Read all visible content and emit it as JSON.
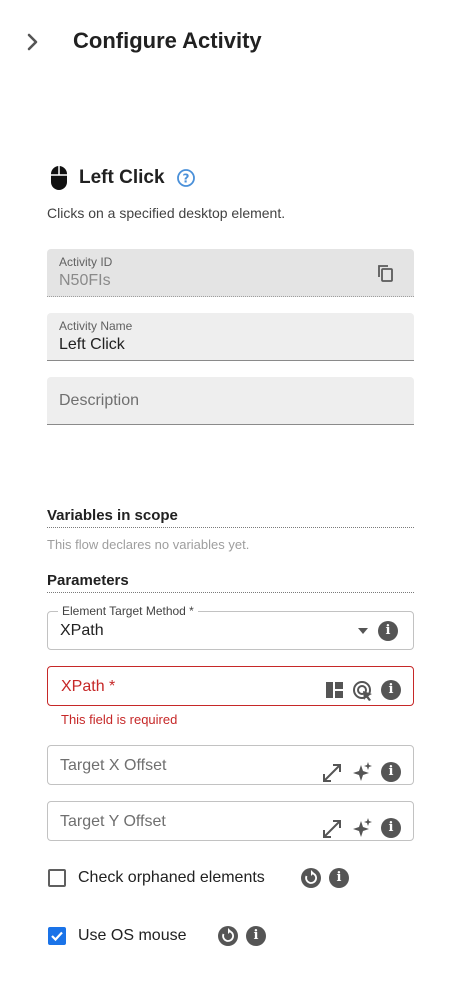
{
  "header": {
    "title": "Configure Activity",
    "toggle_icon": "chevron-right-icon"
  },
  "activity": {
    "icon": "mouse-icon",
    "name": "Left Click",
    "help_icon": "help-circle-icon",
    "description": "Clicks on a specified desktop element."
  },
  "fields": {
    "activity_id": {
      "label": "Activity ID",
      "value": "N50FIs",
      "copy_icon": "copy-icon",
      "disabled": true
    },
    "activity_name": {
      "label": "Activity Name",
      "value": "Left Click"
    },
    "description": {
      "placeholder": "Description",
      "value": ""
    }
  },
  "variables": {
    "title": "Variables in scope",
    "empty_text": "This flow declares no variables yet."
  },
  "parameters": {
    "title": "Parameters",
    "element_target_method": {
      "label": "Element Target Method *",
      "value": "XPath"
    },
    "xpath": {
      "label": "XPath *",
      "error": "This field is required"
    },
    "target_x_offset": {
      "placeholder": "Target X Offset"
    },
    "target_y_offset": {
      "placeholder": "Target Y Offset"
    },
    "check_orphaned": {
      "label": "Check orphaned elements",
      "checked": false
    },
    "use_os_mouse": {
      "label": "Use OS mouse",
      "checked": true
    }
  },
  "colors": {
    "error": "#c62828",
    "accent": "#1a73e8",
    "help": "#4a90d9"
  }
}
